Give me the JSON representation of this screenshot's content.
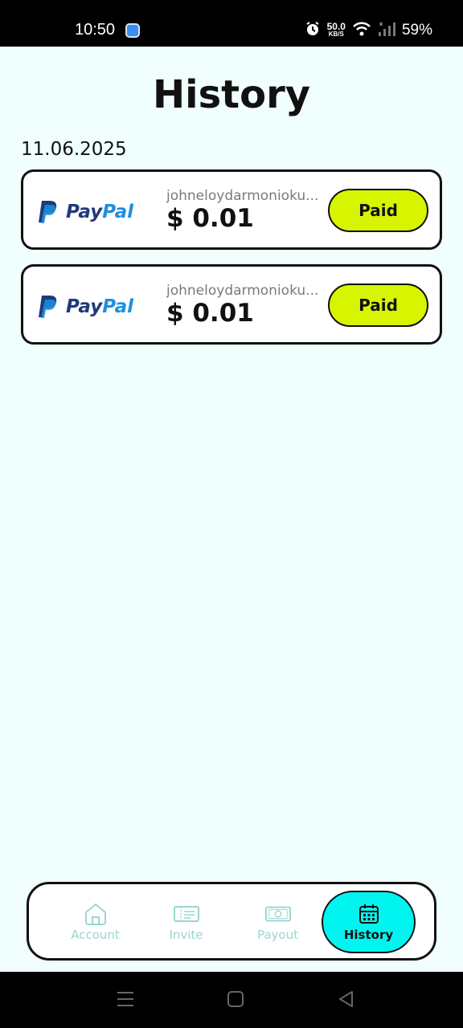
{
  "status": {
    "time": "10:50",
    "net_speed_value": "50.0",
    "net_speed_unit": "KB/S",
    "battery": "59%"
  },
  "page": {
    "title": "History"
  },
  "history": {
    "groups": [
      {
        "date": "11.06.2025",
        "entries": [
          {
            "method": "PayPal",
            "email": "johneloydarmonioku...",
            "amount": "$ 0.01",
            "status": "Paid"
          },
          {
            "method": "PayPal",
            "email": "johneloydarmonioku...",
            "amount": "$ 0.01",
            "status": "Paid"
          }
        ]
      }
    ]
  },
  "nav": {
    "items": [
      {
        "label": "Account",
        "icon": "home-icon"
      },
      {
        "label": "Invite",
        "icon": "ticket-icon"
      },
      {
        "label": "Payout",
        "icon": "money-icon"
      },
      {
        "label": "History",
        "icon": "calendar-icon",
        "active": true
      }
    ]
  },
  "colors": {
    "background": "#f0fffd",
    "paid_badge": "#d7f500",
    "active_tab": "#00f5f0",
    "inactive_tab_text": "#9bd6d2",
    "paypal_dark": "#1f3a7a",
    "paypal_light": "#1d8fe0"
  }
}
